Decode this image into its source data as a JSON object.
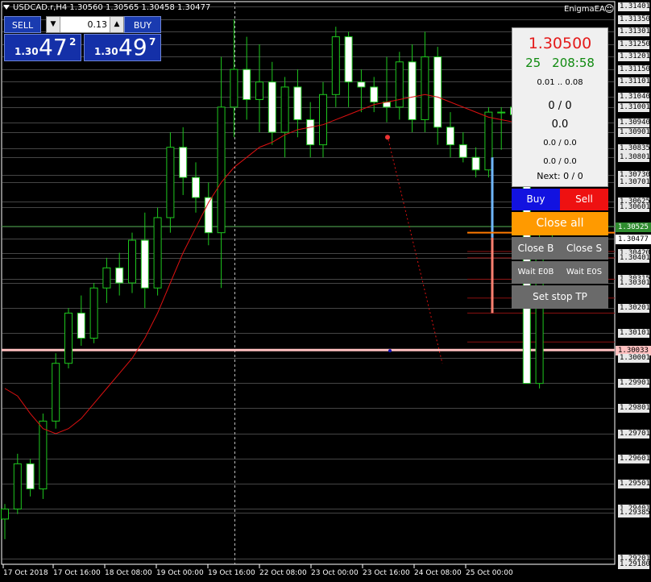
{
  "window": {
    "title": "USDCAD.r,H4  1.30560 1.30565 1.30458 1.30477",
    "expert_name": "EnigmaEA",
    "expert_icon": "smiley-icon"
  },
  "one_click": {
    "sell_label": "SELL",
    "buy_label": "BUY",
    "lot_value": "0.13",
    "sell_quote": {
      "prefix": "1.30",
      "big": "47",
      "sup": "2"
    },
    "buy_quote": {
      "prefix": "1.30",
      "big": "49",
      "sup": "7"
    }
  },
  "panel": {
    "price": "1.30500",
    "spread": "25",
    "timer": "208:58",
    "lot_range": "0.01 .. 0.08",
    "orders": "0 / 0",
    "profit": "0.0",
    "volumes": "0.0 / 0.0",
    "values": "0.0 / 0.0",
    "next": "Next: 0 / 0",
    "buy_label": "Buy",
    "sell_label": "Sell",
    "close_all_label": "Close all",
    "close_b_label": "Close B",
    "close_s_label": "Close S",
    "wait_e0b_label": "Wait E0B",
    "wait_e0s_label": "Wait E0S",
    "set_stop_tp_label": "Set stop TP",
    "colors": {
      "price": "#e41b1b",
      "spread": "#0f8a0f",
      "buy_bg": "#1212e0",
      "sell_bg": "#ee1111",
      "close_all_bg": "#ff9a00",
      "grey_bg": "#6a6a6a"
    }
  },
  "price_axis": {
    "labels": [
      "1.31401",
      "1.31350",
      "1.31301",
      "1.31250",
      "1.31201",
      "1.31150",
      "1.31101",
      "1.31040",
      "1.31001",
      "1.30940",
      "1.30901",
      "1.30835",
      "1.30801",
      "1.30730",
      "1.30701",
      "1.30625",
      "1.30601",
      "1.30525",
      "1.30477",
      "1.30420",
      "1.30401",
      "1.30315",
      "1.30301",
      "1.30201",
      "1.30101",
      "1.30033",
      "1.30001",
      "1.29901",
      "1.29801",
      "1.29701",
      "1.29601",
      "1.29501",
      "1.29401",
      "1.29385",
      "1.29201",
      "1.29180"
    ],
    "current_bid": "1.30477",
    "marked_level": "1.30033",
    "green_level_tag": "1.30525",
    "colors": {
      "bid_tag": "#ffffff",
      "marked_tag": "#ffc0c0",
      "green_tag": "#2e8b2e"
    }
  },
  "time_axis": {
    "labels": [
      "17 Oct 2018",
      "17 Oct 16:00",
      "18 Oct 08:00",
      "19 Oct 00:00",
      "19 Oct 16:00",
      "22 Oct 08:00",
      "23 Oct 00:00",
      "23 Oct 16:00",
      "24 Oct 08:00",
      "25 Oct 00:00"
    ]
  },
  "chart_data": {
    "type": "candlestick",
    "symbol": "USDCAD.r",
    "timeframe": "H4",
    "ylim": [
      1.2918,
      1.3142
    ],
    "candles": [
      {
        "o": 1.2936,
        "h": 1.2942,
        "l": 1.2928,
        "c": 1.294
      },
      {
        "o": 1.294,
        "h": 1.2962,
        "l": 1.2938,
        "c": 1.2958
      },
      {
        "o": 1.2958,
        "h": 1.296,
        "l": 1.2945,
        "c": 1.2948
      },
      {
        "o": 1.2948,
        "h": 1.2978,
        "l": 1.2944,
        "c": 1.2975
      },
      {
        "o": 1.2975,
        "h": 1.3002,
        "l": 1.2972,
        "c": 1.2998
      },
      {
        "o": 1.2998,
        "h": 1.302,
        "l": 1.2996,
        "c": 1.3018
      },
      {
        "o": 1.3018,
        "h": 1.3025,
        "l": 1.3005,
        "c": 1.3008
      },
      {
        "o": 1.3008,
        "h": 1.303,
        "l": 1.3006,
        "c": 1.3028
      },
      {
        "o": 1.3028,
        "h": 1.304,
        "l": 1.3022,
        "c": 1.3036
      },
      {
        "o": 1.3036,
        "h": 1.3042,
        "l": 1.3025,
        "c": 1.303
      },
      {
        "o": 1.303,
        "h": 1.305,
        "l": 1.3026,
        "c": 1.3047
      },
      {
        "o": 1.3047,
        "h": 1.3058,
        "l": 1.302,
        "c": 1.3028
      },
      {
        "o": 1.3028,
        "h": 1.306,
        "l": 1.3025,
        "c": 1.3056
      },
      {
        "o": 1.3056,
        "h": 1.309,
        "l": 1.305,
        "c": 1.3084
      },
      {
        "o": 1.3084,
        "h": 1.3092,
        "l": 1.3065,
        "c": 1.3072
      },
      {
        "o": 1.3072,
        "h": 1.3078,
        "l": 1.3058,
        "c": 1.3064
      },
      {
        "o": 1.3064,
        "h": 1.307,
        "l": 1.3045,
        "c": 1.305
      },
      {
        "o": 1.305,
        "h": 1.312,
        "l": 1.3028,
        "c": 1.31
      },
      {
        "o": 1.31,
        "h": 1.3135,
        "l": 1.3088,
        "c": 1.3115
      },
      {
        "o": 1.3115,
        "h": 1.3128,
        "l": 1.3095,
        "c": 1.3103
      },
      {
        "o": 1.3103,
        "h": 1.3125,
        "l": 1.309,
        "c": 1.311
      },
      {
        "o": 1.311,
        "h": 1.3118,
        "l": 1.3085,
        "c": 1.309
      },
      {
        "o": 1.309,
        "h": 1.3112,
        "l": 1.308,
        "c": 1.3108
      },
      {
        "o": 1.3108,
        "h": 1.3115,
        "l": 1.3088,
        "c": 1.3095
      },
      {
        "o": 1.3095,
        "h": 1.3102,
        "l": 1.308,
        "c": 1.3085
      },
      {
        "o": 1.3085,
        "h": 1.311,
        "l": 1.308,
        "c": 1.3105
      },
      {
        "o": 1.3105,
        "h": 1.3132,
        "l": 1.31,
        "c": 1.3128
      },
      {
        "o": 1.3128,
        "h": 1.313,
        "l": 1.31,
        "c": 1.311
      },
      {
        "o": 1.311,
        "h": 1.3115,
        "l": 1.3098,
        "c": 1.3108
      },
      {
        "o": 1.3108,
        "h": 1.3112,
        "l": 1.3098,
        "c": 1.3102
      },
      {
        "o": 1.3102,
        "h": 1.312,
        "l": 1.3094,
        "c": 1.31
      },
      {
        "o": 1.31,
        "h": 1.3122,
        "l": 1.3095,
        "c": 1.3118
      },
      {
        "o": 1.3118,
        "h": 1.3125,
        "l": 1.309,
        "c": 1.3095
      },
      {
        "o": 1.3095,
        "h": 1.313,
        "l": 1.309,
        "c": 1.312
      },
      {
        "o": 1.312,
        "h": 1.3124,
        "l": 1.3085,
        "c": 1.3092
      },
      {
        "o": 1.3092,
        "h": 1.3098,
        "l": 1.308,
        "c": 1.3085
      },
      {
        "o": 1.3085,
        "h": 1.309,
        "l": 1.3078,
        "c": 1.308
      },
      {
        "o": 1.308,
        "h": 1.3084,
        "l": 1.3072,
        "c": 1.3075
      },
      {
        "o": 1.3075,
        "h": 1.31,
        "l": 1.3072,
        "c": 1.3098
      },
      {
        "o": 1.3098,
        "h": 1.31,
        "l": 1.3083,
        "c": 1.3098
      },
      {
        "o": 1.31,
        "h": 1.3102,
        "l": 1.3093,
        "c": 1.3097
      },
      {
        "o": 1.3098,
        "h": 1.31,
        "l": 1.299,
        "c": 1.299
      },
      {
        "o": 1.299,
        "h": 1.305,
        "l": 1.2988,
        "c": 1.3045
      },
      {
        "o": 1.3045,
        "h": 1.3058,
        "l": 1.304,
        "c": 1.3048
      }
    ],
    "moving_average": [
      1.2988,
      1.2985,
      1.2978,
      1.2972,
      1.297,
      1.2972,
      1.2976,
      1.2982,
      1.2988,
      1.2994,
      1.3,
      1.3008,
      1.3018,
      1.303,
      1.3042,
      1.3052,
      1.3062,
      1.307,
      1.3076,
      1.308,
      1.3084,
      1.3086,
      1.3089,
      1.3091,
      1.3092,
      1.3093,
      1.3095,
      1.3097,
      1.3099,
      1.3101,
      1.3102,
      1.3103,
      1.3104,
      1.3105,
      1.3104,
      1.3102,
      1.31,
      1.3098,
      1.3096,
      1.3095,
      1.3094,
      1.309,
      1.3086,
      1.3082
    ],
    "horizontal_levels": [
      1.30525,
      1.30477,
      1.30033
    ]
  }
}
